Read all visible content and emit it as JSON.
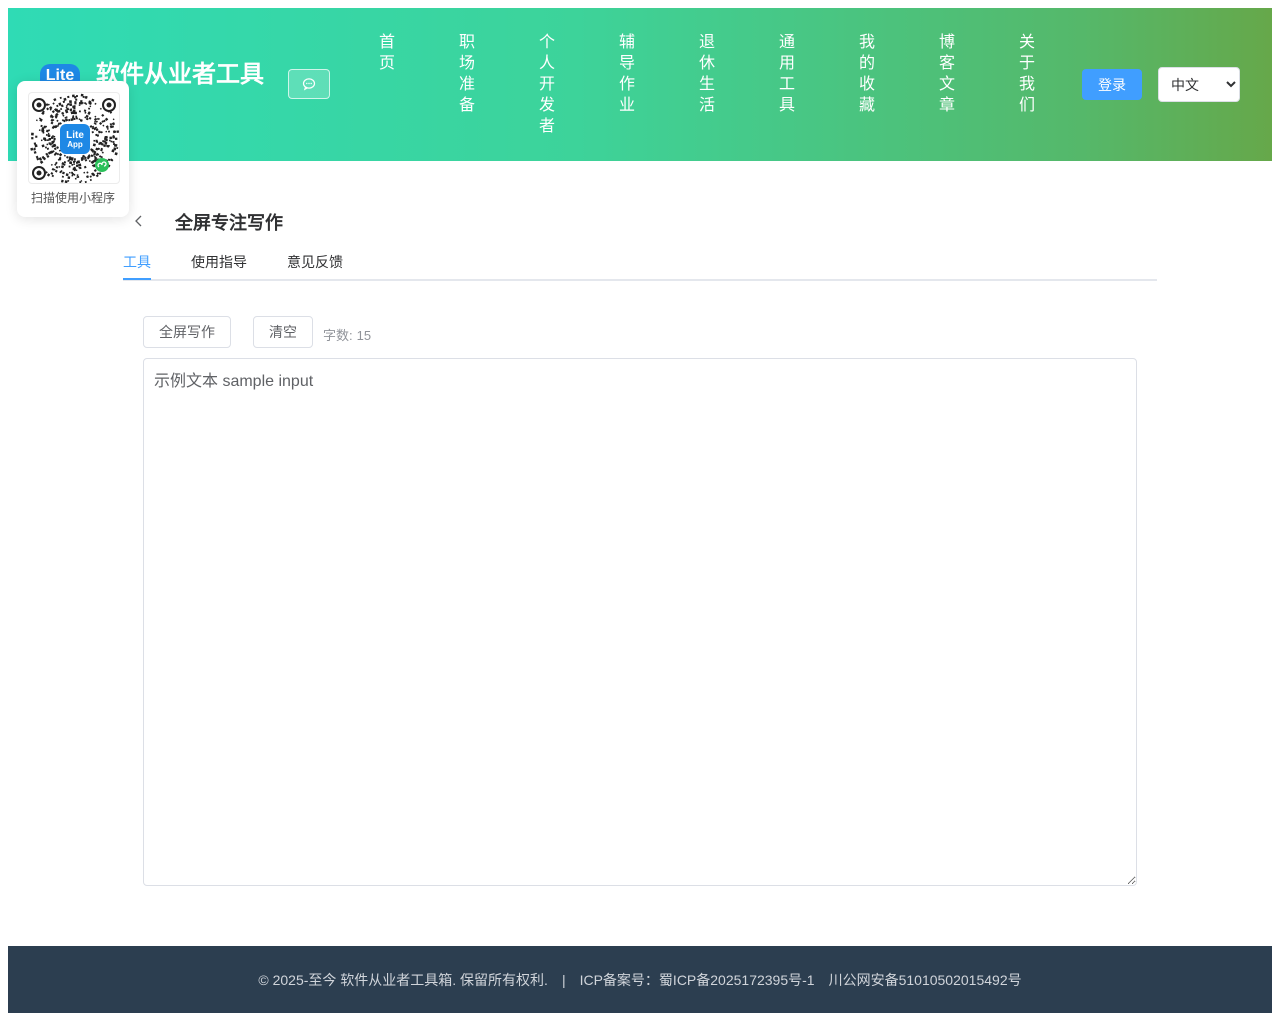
{
  "header": {
    "logo_text": "Lite",
    "site_title": "软件从业者工具",
    "chat_icon": "chat-bubble-icon",
    "nav": [
      {
        "id": "home",
        "label": "首页"
      },
      {
        "id": "career",
        "label": "职场准备"
      },
      {
        "id": "indie",
        "label": "个人开发者"
      },
      {
        "id": "homework",
        "label": "辅导作业"
      },
      {
        "id": "retire",
        "label": "退休生活"
      },
      {
        "id": "tools",
        "label": "通用工具"
      },
      {
        "id": "favorites",
        "label": "我的收藏"
      },
      {
        "id": "blog",
        "label": "博客文章"
      },
      {
        "id": "about",
        "label": "关于我们"
      }
    ],
    "login_label": "登录",
    "language": {
      "selected": "中文"
    }
  },
  "qr_card": {
    "badge_line1": "Lite",
    "badge_line2": "App",
    "caption": "扫描使用小程序"
  },
  "page": {
    "title": "全屏专注写作",
    "tabs": [
      {
        "id": "tool",
        "label": "工具",
        "active": true
      },
      {
        "id": "guide",
        "label": "使用指导",
        "active": false
      },
      {
        "id": "feedback",
        "label": "意见反馈",
        "active": false
      }
    ]
  },
  "toolbar": {
    "fullscreen_label": "全屏写作",
    "clear_label": "清空",
    "count_label": "字数:",
    "count_value": "15"
  },
  "editor": {
    "value": "示例文本 sample input"
  },
  "footer": {
    "copyright": "© 2025-至今 软件从业者工具箱. 保留所有权利.",
    "separator": "|",
    "icp": "ICP备案号：蜀ICP备2025172395号-1",
    "psb": "川公网安备51010502015492号"
  },
  "colors": {
    "primary": "#409eff",
    "header_gradient_start": "#2fdbb5",
    "header_gradient_end": "#66a84a",
    "footer_bg": "#2c3e50"
  }
}
